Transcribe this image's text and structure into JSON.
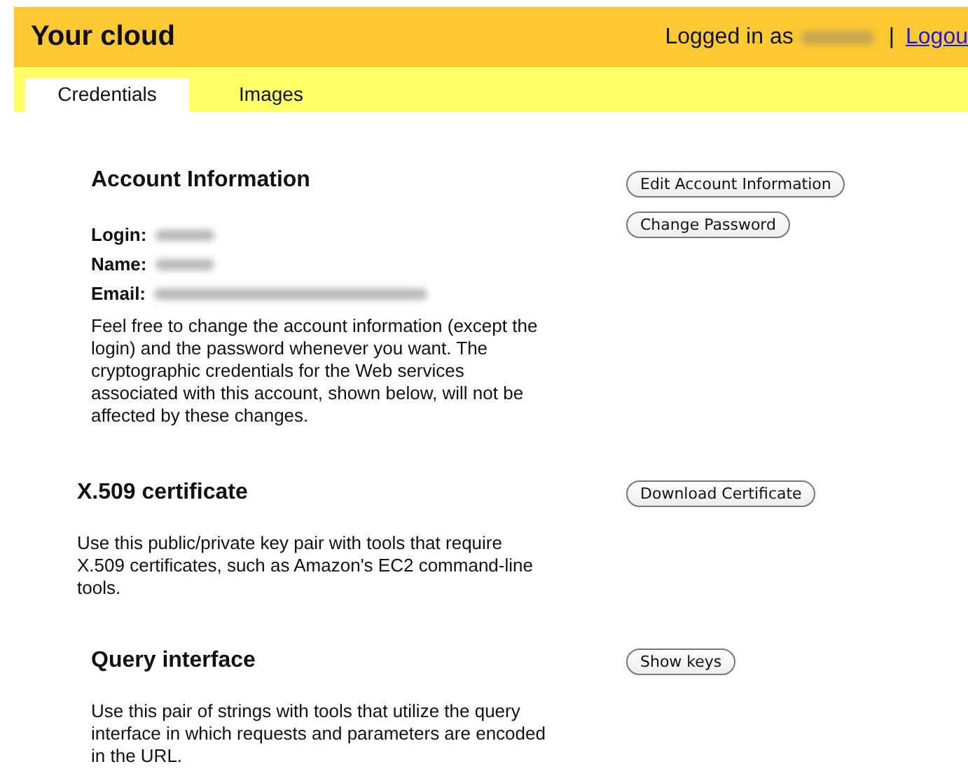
{
  "header": {
    "title": "Your cloud",
    "logged_in_label": "Logged in as",
    "separator": "|",
    "logout_link": "Logou"
  },
  "tabs": [
    {
      "label": "Credentials",
      "selected": true
    },
    {
      "label": "Images",
      "selected": false
    }
  ],
  "sections": [
    {
      "title": "Account Information",
      "fields": [
        {
          "label": "Login:",
          "redacted": true
        },
        {
          "label": "Name:",
          "redacted": true
        },
        {
          "label": "Email:",
          "redacted": true
        }
      ],
      "text": "Feel free to change the account information (except the login) and the password whenever you want. The cryptographic credentials for the Web services associated with this account, shown below, will not be affected by these changes.",
      "buttons": [
        "Edit Account Information",
        "Change Password"
      ]
    },
    {
      "title": "X.509 certificate",
      "text": "Use this public/private key pair with tools that require X.509 certificates, such as Amazon's EC2 command-line tools.",
      "buttons": [
        "Download Certificate"
      ]
    },
    {
      "title": "Query interface",
      "text": "Use this pair of strings with tools that utilize the query interface in which requests and parameters are encoded in the URL.",
      "buttons": [
        "Show keys"
      ]
    }
  ]
}
